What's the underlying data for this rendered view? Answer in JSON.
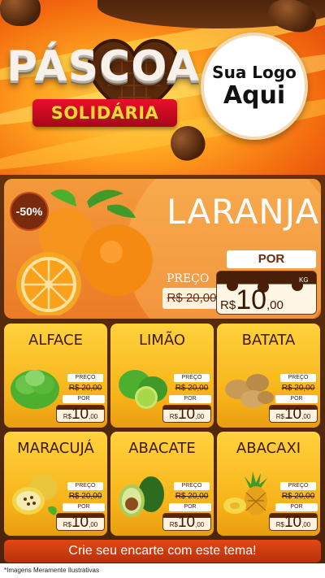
{
  "header": {
    "title": "PÁSCOA",
    "subtitle": "SOLIDÁRIA",
    "logo_line1": "Sua Logo",
    "logo_line2": "Aqui"
  },
  "featured": {
    "name": "LARANJA",
    "discount": "-50%",
    "preco_label": "PREÇO",
    "old_price": "R$ 20,00",
    "por_label": "POR",
    "currency": "R$",
    "new_price_int": "10",
    "new_price_dec": ",00",
    "unit": "KG"
  },
  "products": [
    {
      "name": "ALFACE",
      "preco_label": "PREÇO",
      "old_price": "R$ 20,00",
      "por_label": "POR",
      "currency": "R$",
      "new_price_int": "10",
      "new_price_dec": ",00"
    },
    {
      "name": "LIMÃO",
      "preco_label": "PREÇO",
      "old_price": "R$ 20,00",
      "por_label": "POR",
      "currency": "R$",
      "new_price_int": "10",
      "new_price_dec": ",00"
    },
    {
      "name": "BATATA",
      "preco_label": "PREÇO",
      "old_price": "R$ 20,00",
      "por_label": "POR",
      "currency": "R$",
      "new_price_int": "10",
      "new_price_dec": ",00"
    },
    {
      "name": "MARACUJÁ",
      "preco_label": "PREÇO",
      "old_price": "R$ 20,00",
      "por_label": "POR",
      "currency": "R$",
      "new_price_int": "10",
      "new_price_dec": ",00"
    },
    {
      "name": "ABACATE",
      "preco_label": "PREÇO",
      "old_price": "R$ 20,00",
      "por_label": "POR",
      "currency": "R$",
      "new_price_int": "10",
      "new_price_dec": ",00"
    },
    {
      "name": "ABACAXI",
      "preco_label": "PREÇO",
      "old_price": "R$ 20,00",
      "por_label": "POR",
      "currency": "R$",
      "new_price_int": "10",
      "new_price_dec": ",00"
    }
  ],
  "footer": {
    "cta": "Crie seu encarte com este tema!",
    "disclaimer": "*Imagens Meramente Ilustrativas"
  },
  "colors": {
    "brown": "#4a240b",
    "orange": "#ec7b26",
    "yellow": "#ffd23c",
    "red": "#e24812"
  }
}
